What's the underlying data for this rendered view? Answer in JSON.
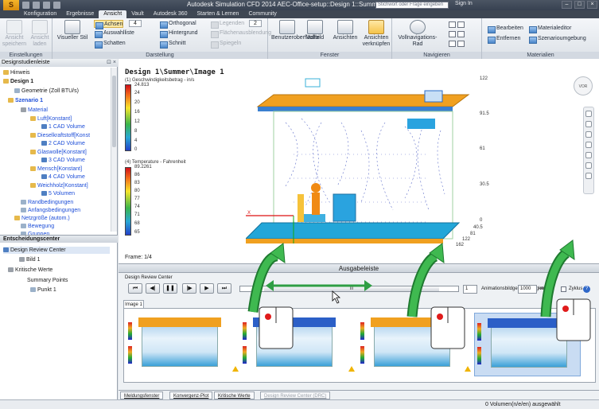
{
  "titlebar": {
    "app_letter": "S",
    "title": "Autodesk Simulation CFD 2014   AEC-Office-setup::Design 1::Summer",
    "search_placeholder": "Stichwort oder Frage eingeben",
    "sign_in": "Sign In"
  },
  "tabs": [
    "Konfiguration",
    "Ergebnisse",
    "Ansicht",
    "Vault",
    "Autodesk 360",
    "Starten & Lernen",
    "Community"
  ],
  "ribbon": {
    "einstellungen": {
      "label": "Einstellungen",
      "save": "Ansicht speichern",
      "load": "Ansicht laden"
    },
    "darstellung": {
      "label": "Darstellung",
      "visual_style": "Visueller Stil",
      "achsen": "Achsen",
      "achsen_value": "4",
      "auswahlliste": "Auswahlliste",
      "schatten": "Schatten",
      "orthogonal": "Orthogonal",
      "hintergrund": "Hintergrund",
      "schnitt": "Schnitt",
      "legenden": "Legenden",
      "legenden_value": "2",
      "flaechenausblendung": "Flächenausblendung",
      "spiegeln": "Spiegeln"
    },
    "fenster": {
      "label": "Fenster",
      "benutzer": "Benutzeroberfläche",
      "vollbild": "Vollbild",
      "ansichten": "Ansichten",
      "verknuepfen": "Ansichten verknüpfen"
    },
    "navigieren": {
      "label": "Navigieren",
      "vollnav": "Vollnavigations-Rad"
    },
    "materialien": {
      "label": "Materialien",
      "bearbeiten": "Bearbeiten",
      "entfernen": "Entfernen",
      "materialeditor": "Materialeditor",
      "szenario": "Szenarioumgebung"
    }
  },
  "left_panel": {
    "title": "Designstudienleiste",
    "tree": {
      "hinweis": "Hinweis",
      "design": "Design 1",
      "geometrie": "Geometrie (Zoll BTU/s)",
      "szenario": "Szenario 1",
      "material": "Material",
      "materials": [
        {
          "name": "Luft[Konstant]",
          "volume": "1 CAD Volume"
        },
        {
          "name": "Dieselkraftstoff[Konst",
          "volume": "2 CAD Volume"
        },
        {
          "name": "Glaswolle[Konstant]",
          "volume": "3 CAD Volume"
        },
        {
          "name": "Mensch[Konstant]",
          "volume": "4 CAD Volume"
        },
        {
          "name": "Weichholz[Konstant]",
          "volume": "5 Volumen"
        }
      ],
      "rand": "Randbedingungen",
      "anfang": "Anfangsbedingungen",
      "netz": "Netzgröße (autom.)",
      "bewegung": "Bewegung",
      "gruppen": "Gruppen"
    },
    "entscheidung": {
      "title": "Entscheidungscenter",
      "drc": "Design Review Center",
      "bild": "Bild 1",
      "kritisch": "Kritische Werte",
      "summary": "Summary Points",
      "punkt": "Punkt 1"
    }
  },
  "viewport": {
    "title": "Design 1\\Summer\\Image 1",
    "legend1_label": "(1) Geschwindigkeitsbetrag - in/s",
    "legend1_ticks": [
      "24.813",
      "24",
      "20",
      "16",
      "12",
      "8",
      "4",
      "0"
    ],
    "legend2_label": "(4) Temperature - Fahrenheit",
    "legend2_ticks": [
      "89.2261",
      "86",
      "83",
      "80",
      "77",
      "74",
      "71",
      "68",
      "65"
    ],
    "frame": "Frame: 1/4",
    "navcube": "VOR",
    "axis_right": [
      "122",
      "91.5",
      "61",
      "30.5",
      "0"
    ],
    "axis_bottom": [
      "40.5",
      "81",
      "122",
      "162"
    ],
    "axis_x_label": "X"
  },
  "output": {
    "title": "Ausgabeleiste",
    "drc_label": "Design Review Center",
    "slider_center": "III",
    "frame_value": "1",
    "speed_label": "Animationsbildgeschwindigkeit:",
    "speed_value": "1000",
    "speed_unit": "ms",
    "cycle": "Zyklus",
    "image_tab": "Image 1"
  },
  "bottom_tabs": [
    "Meldungsfenster",
    "Konvergenz-Plot",
    "Kritische Werte",
    "Design Review Center (DRC)"
  ],
  "status": "0 Volumen(n/e/en) ausgewählt",
  "colors": {
    "accent": "#2f9e44",
    "selection": "#c9dcf3",
    "tab_active": "#e9edf2"
  }
}
